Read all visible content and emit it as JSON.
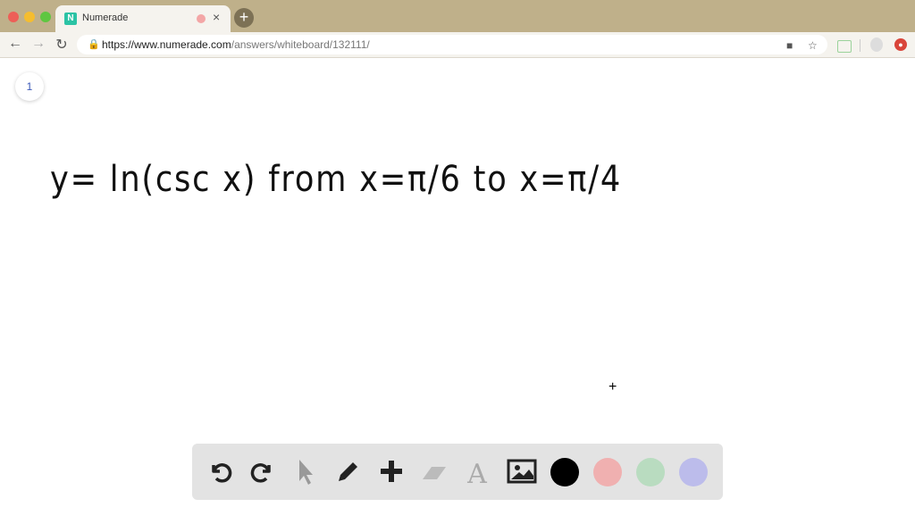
{
  "browser": {
    "tab": {
      "title": "Numerade",
      "favicon_letter": "N",
      "close": "×"
    },
    "new_tab": "+",
    "url_domain": "https://www.numerade.com",
    "url_path": "/answers/whiteboard/132111/"
  },
  "whiteboard": {
    "page_number": "1",
    "formula": "y= ln(csc x)  from  x=π/6  to  x=π/4"
  },
  "toolbar": {
    "tools": [
      "undo-icon",
      "redo-icon",
      "pointer-icon",
      "pen-icon",
      "plus-icon",
      "eraser-icon",
      "text-icon",
      "image-icon"
    ],
    "colors": [
      "#000000",
      "#f0b0b0",
      "#b9dcc0",
      "#bcbceb"
    ]
  }
}
